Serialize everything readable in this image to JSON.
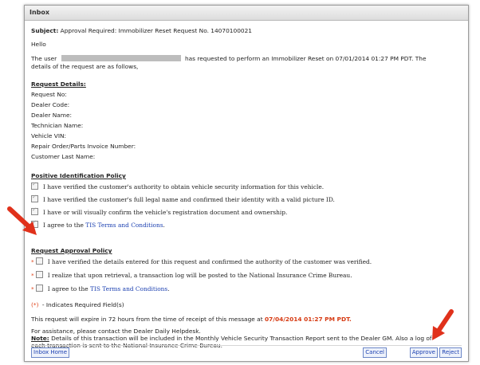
{
  "window": {
    "title": "Inbox"
  },
  "message": {
    "subject_label": "Subject:",
    "subject": "Approval Required: Immobilizer Reset Request No. 14070100021",
    "greeting": "Hello",
    "intro_pre": "The user",
    "intro_post": "has requested to perform an Immobilizer Reset on 07/01/2014 01:27 PM PDT. The",
    "intro_line2": "details of the request are as follows,"
  },
  "request_details": {
    "heading": "Request Details:",
    "fields": [
      "Request No:",
      "Dealer Code:",
      "Dealer Name:",
      "Technician Name:",
      "Vehicle VIN:",
      "Repair Order/Parts Invoice Number:",
      "Customer Last Name:"
    ]
  },
  "positive_id_policy": {
    "heading": "Positive Identification Policy",
    "items": [
      "I have verified the customer's authority to obtain vehicle security information for this vehicle.",
      "I have verified the customer's full legal name and confirmed their identity with a valid picture ID.",
      "I have or will visually confirm the vehicle's registration document and ownership."
    ],
    "agree_pre": "I agree to the",
    "agree_link": "TIS Terms and Conditions",
    "agree_post": "."
  },
  "approval_policy": {
    "heading": "Request Approval Policy",
    "required_mark": "*",
    "items": [
      "I have verified the details entered for this request and confirmed the authority of the customer was verified.",
      "I realize that upon retrieval, a transaction log will be posted to the National Insurance Crime Bureau."
    ],
    "agree_pre": "I agree to the",
    "agree_link": "TIS Terms and Conditions",
    "agree_post": "."
  },
  "footer": {
    "required_note_mark": "(*)",
    "required_note": " - Indicates Required Field(s)",
    "expire_pre": "This request will expire in 72 hours from the time of receipt of this message at",
    "expire_time": "07/04/2014 01:27 PM PDT",
    "expire_post": ".",
    "assistance": "For assistance, please contact the Dealer Daily Helpdesk.",
    "note_label": "Note:",
    "note_text": "Details of this transaction will be included in the Monthly Vehicle Security Transaction Report sent to the Dealer GM. Also a log of",
    "note_line2": "each transaction is sent to the National Insurance Crime Bureau."
  },
  "buttons": {
    "inbox_home": "Inbox Home",
    "cancel": "Cancel",
    "approve": "Approve",
    "reject": "Reject"
  },
  "colors": {
    "arrow": "#e0311b",
    "link": "#1a3fb0",
    "expire": "#d63a12"
  }
}
